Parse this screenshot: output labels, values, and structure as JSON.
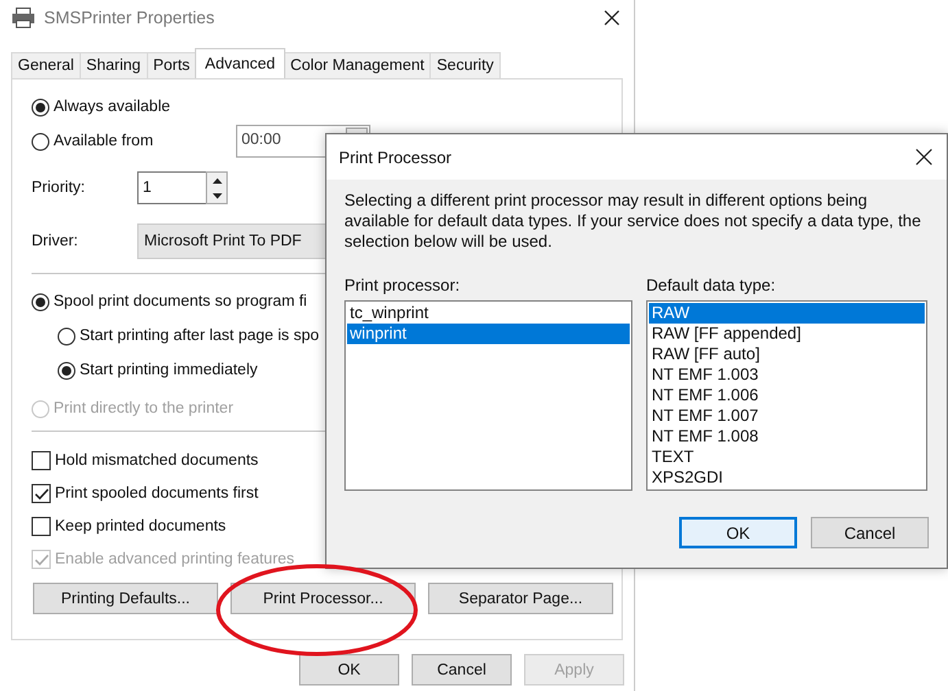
{
  "window": {
    "title": "SMSPrinter Properties"
  },
  "tabs": [
    {
      "label": "General",
      "selected": false
    },
    {
      "label": "Sharing",
      "selected": false
    },
    {
      "label": "Ports",
      "selected": false
    },
    {
      "label": "Advanced",
      "selected": true
    },
    {
      "label": "Color Management",
      "selected": false
    },
    {
      "label": "Security",
      "selected": false
    }
  ],
  "availability": [
    {
      "label": "Always available",
      "selected": true
    },
    {
      "label": "Available from",
      "selected": false
    }
  ],
  "time_from": {
    "value": "00:00"
  },
  "priority": {
    "label": "Priority:",
    "value": "1"
  },
  "driver": {
    "label": "Driver:",
    "value": "Microsoft Print To PDF"
  },
  "spooling": [
    {
      "label": "Spool print documents so program fi",
      "selected": true,
      "disabled": false,
      "children": [
        {
          "label": "Start printing after last page is spo",
          "selected": false,
          "disabled": false
        },
        {
          "label": "Start printing immediately",
          "selected": true,
          "disabled": false
        }
      ]
    },
    {
      "label": "Print directly to the printer",
      "selected": false,
      "disabled": true
    }
  ],
  "checkboxes": [
    {
      "label": "Hold mismatched documents",
      "checked": false,
      "disabled": false
    },
    {
      "label": "Print spooled documents first",
      "checked": true,
      "disabled": false
    },
    {
      "label": "Keep printed documents",
      "checked": false,
      "disabled": false
    },
    {
      "label": "Enable advanced printing features",
      "checked": true,
      "disabled": true
    }
  ],
  "panel_buttons": [
    "Printing Defaults...",
    "Print Processor...",
    "Separator Page..."
  ],
  "footer_buttons": [
    {
      "label": "OK",
      "disabled": false
    },
    {
      "label": "Cancel",
      "disabled": false
    },
    {
      "label": "Apply",
      "disabled": true
    }
  ],
  "dialog": {
    "title": "Print Processor",
    "description": "Selecting a different print processor may result in different options being available for default data types. If your service does not specify a data type, the selection below will be used.",
    "processor_label": "Print processor:",
    "processors": [
      {
        "label": "tc_winprint",
        "selected": false
      },
      {
        "label": "winprint",
        "selected": true
      }
    ],
    "datatype_label": "Default data type:",
    "datatypes": [
      {
        "label": "RAW",
        "selected": true
      },
      {
        "label": "RAW [FF appended]",
        "selected": false
      },
      {
        "label": "RAW [FF auto]",
        "selected": false
      },
      {
        "label": "NT EMF 1.003",
        "selected": false
      },
      {
        "label": "NT EMF 1.006",
        "selected": false
      },
      {
        "label": "NT EMF 1.007",
        "selected": false
      },
      {
        "label": "NT EMF 1.008",
        "selected": false
      },
      {
        "label": "TEXT",
        "selected": false
      },
      {
        "label": "XPS2GDI",
        "selected": false
      }
    ],
    "buttons": [
      {
        "label": "OK",
        "default": true
      },
      {
        "label": "Cancel",
        "default": false
      }
    ]
  }
}
